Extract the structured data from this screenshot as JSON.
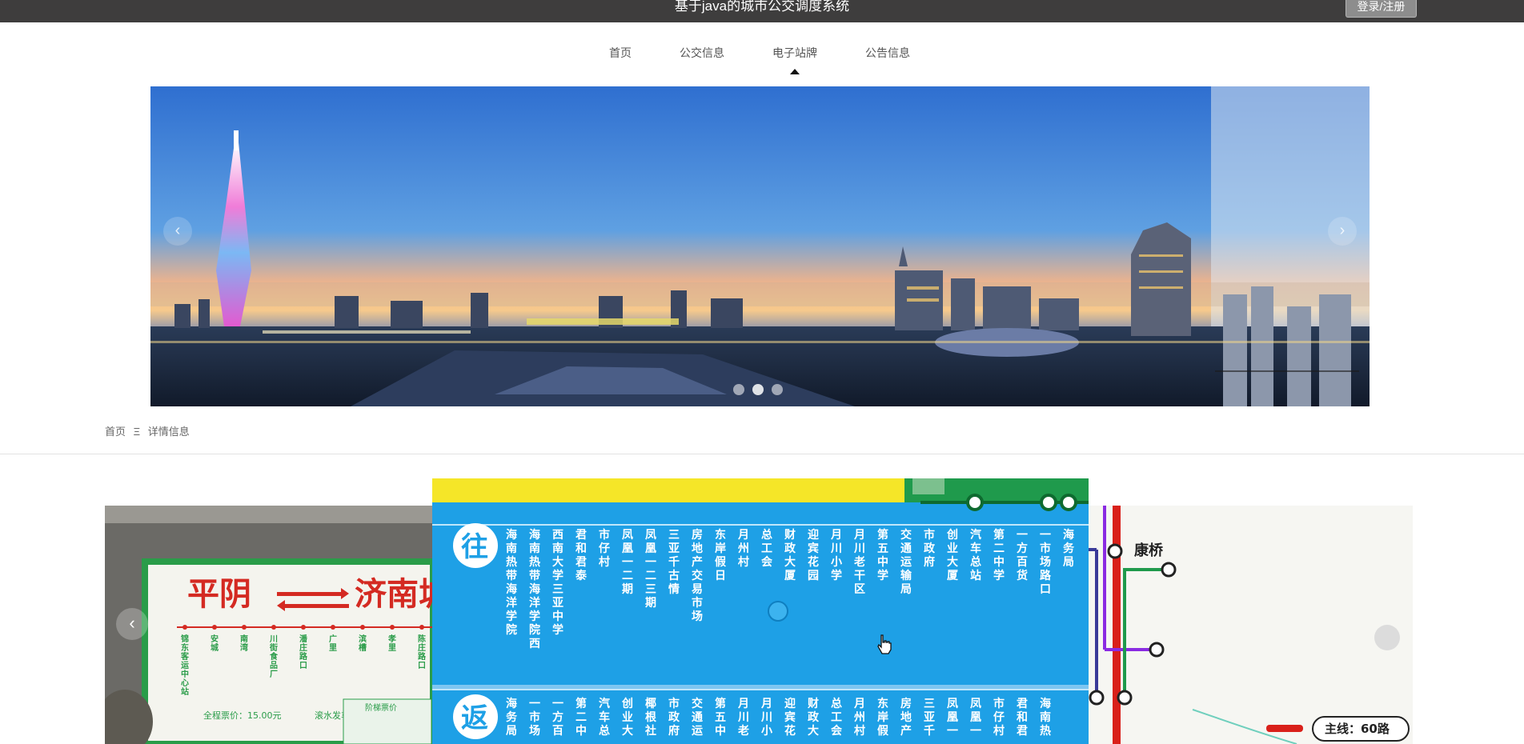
{
  "header": {
    "title": "基于java的城市公交调度系统",
    "login_label": "登录/注册"
  },
  "nav": {
    "items": [
      {
        "label": "首页"
      },
      {
        "label": "公交信息"
      },
      {
        "label": "电子站牌",
        "active": true
      },
      {
        "label": "公告信息"
      }
    ]
  },
  "banner": {
    "prev_label": "‹",
    "next_label": "›",
    "slide_count": 3,
    "active_slide": 1
  },
  "breadcrumb": {
    "home": "首页",
    "separator": "Ξ",
    "current": "详情信息"
  },
  "gallery": {
    "left_sign": {
      "origin": "平阴",
      "destination": "济南城际",
      "stations": [
        "锦东客运中心站",
        "安城",
        "南湾",
        "川街食品厂",
        "潘庄路口",
        "广里",
        "滨槽",
        "孝里",
        "陈庄路口"
      ],
      "fare_text": "全程票价：15.00元",
      "depart_text": "滚水发车",
      "info_header": "阶梯票价"
    },
    "center_sign": {
      "outbound_label": "往",
      "return_label": "返",
      "outbound_stations": [
        "海南热带海洋学院",
        "海南热带海洋学院西门",
        "西南大学三亚中学",
        "君和君泰",
        "市仔村",
        "凤凰一二期",
        "凤凰一二三期",
        "三亚千古情",
        "房地产交易市场",
        "东岸假日",
        "月州村",
        "总工会",
        "财政大厦",
        "迎宾花园",
        "月川小学",
        "月川老干区",
        "第五中学",
        "交通运输局",
        "市政府",
        "创业大厦",
        "汽车总站",
        "第二中学",
        "一方百货",
        "一市场路口",
        "海务局"
      ],
      "return_stations": [
        "海务局",
        "一市场路口",
        "一方百货",
        "第二中学",
        "汽车总站",
        "创业大厦",
        "椰根社",
        "市政府",
        "交通运输局",
        "第五中学",
        "月川老干区",
        "月川小学",
        "迎宾花园",
        "财政大厦",
        "总工会",
        "月州村",
        "东岸假日",
        "房地产",
        "三亚千古情",
        "凤凰一二期",
        "凤凰一二",
        "市仔村",
        "君和君泰",
        "海南热带"
      ]
    },
    "right_map": {
      "station_label": "康桥",
      "line_badge": "主线：60路"
    },
    "prev_label": "‹",
    "colors": {
      "sign_blue": "#1ea0e6",
      "sign_yellow": "#f5e628",
      "sign_green": "#1f9a4c",
      "sign_red": "#d9201a"
    }
  }
}
